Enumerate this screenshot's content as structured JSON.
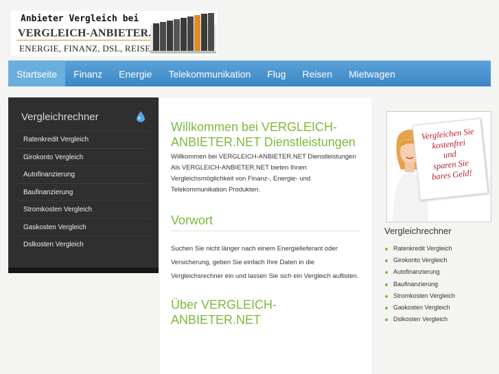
{
  "logo": {
    "line1": "Anbieter Vergleich bei",
    "line2": "VERGLEICH-ANBIETER.NET",
    "line3": "ENERGIE, FINANZ, DSL, REISEN"
  },
  "nav": {
    "items": [
      {
        "label": "Startseite",
        "active": true
      },
      {
        "label": "Finanz"
      },
      {
        "label": "Energie"
      },
      {
        "label": "Telekommunikation"
      },
      {
        "label": "Flug"
      },
      {
        "label": "Reisen"
      },
      {
        "label": "Mietwagen"
      }
    ]
  },
  "left_sidebar": {
    "title": "Vergleichrechner",
    "items": [
      "Ratenkredit Vergleich",
      "Girokonto Vergleich",
      "Autofinanzierung",
      "Baufinanzierung",
      "Stromkosten Vergleich",
      "Gaskosten Vergleich",
      "Dslkosten Vergleich"
    ]
  },
  "content": {
    "welcome_heading": "Willkommen bei VERGLEICH-ANBIETER.NET Dienstleistungen",
    "welcome_line1": "Willkommen bei VERGLEICH-ANBIETER.NET Dienstleistungen",
    "welcome_line2": "Als VERGLEICH-ANBIETER.NET bieten Ihnen Vergleichsmöglichkeit von Finanz-, Energie- und Telekommunikation Produkten.",
    "vorwort_heading": "Vorwort",
    "vorwort_text": "Suchen Sie nicht länger nach einem Energielieferant oder Versicherung, geben Sie einfach Ihre Daten in die Vergleichsrechner ein und lassen Sie sich ein Vergleich auflisten.",
    "ueber_heading": "Über VERGLEICH-ANBIETER.NET"
  },
  "right_sidebar": {
    "promo_text": [
      "Vergleichen Sie",
      "kostenfrei",
      "und",
      "sparen Sie",
      "bares Geld!"
    ],
    "title": "Vergleichrechner",
    "items": [
      "Ratenkredit Vergleich",
      "Girokonto Vergleich",
      "Autofinanzierung",
      "Baufinanzierung",
      "Stromkosten Vergleich",
      "Gaskosten Vergleich",
      "Dslkosten Vergleich"
    ]
  },
  "colors": {
    "nav_blue": "#4a94ce",
    "heading_green": "#7cba3b",
    "sidebar_dark": "#2f2f2f",
    "promo_red": "#b8202a"
  }
}
